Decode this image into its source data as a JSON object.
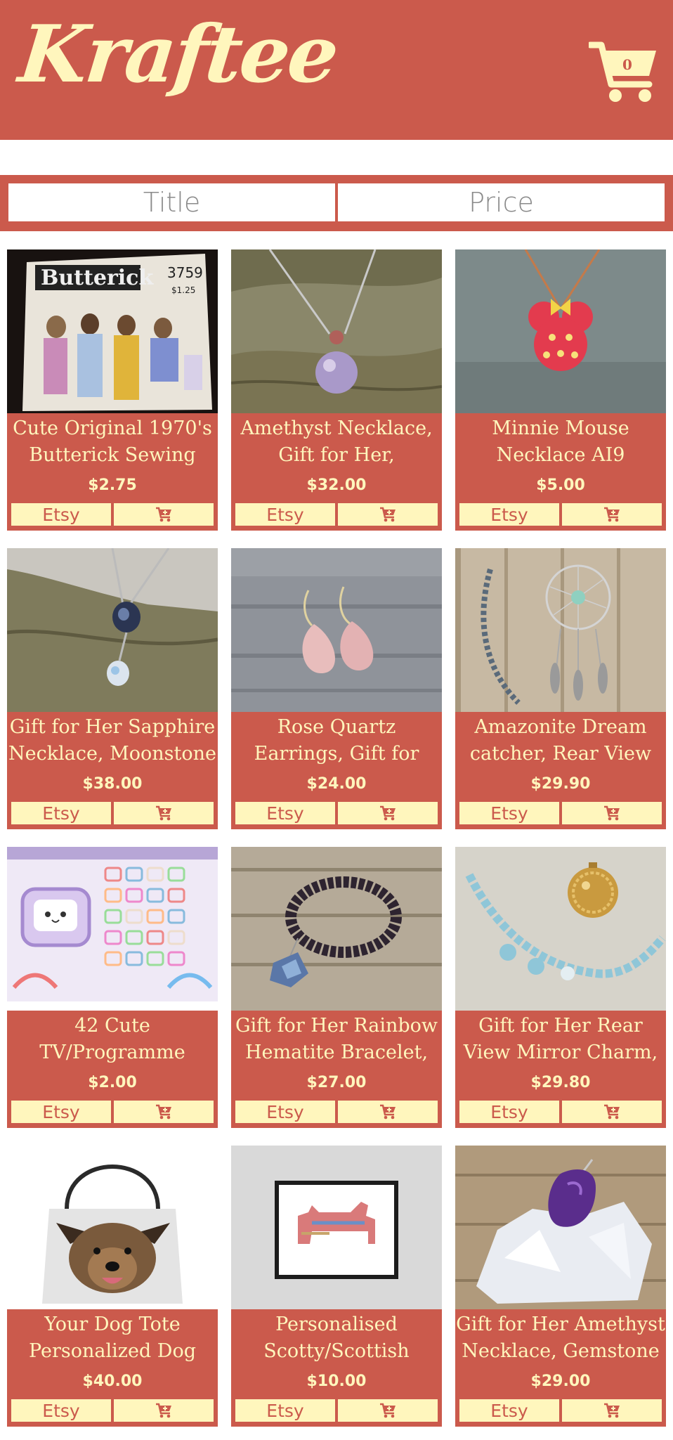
{
  "brand": {
    "name": "Kraftee"
  },
  "cart": {
    "count": "0",
    "icon": "shopping-cart-icon"
  },
  "sort": {
    "title_label": "Title",
    "price_label": "Price"
  },
  "colors": {
    "primary": "#cb5a4c",
    "cream": "#fff6bd"
  },
  "products": [
    {
      "title": "Cute Original 1970's Butterick Sewing",
      "price": "$2.75",
      "shop_label": "Etsy",
      "image": "sewing-pattern"
    },
    {
      "title": "Amethyst Necklace, Gift for Her,",
      "price": "$32.00",
      "shop_label": "Etsy",
      "image": "amethyst-necklace"
    },
    {
      "title": "Minnie Mouse Necklace AI9",
      "price": "$5.00",
      "shop_label": "Etsy",
      "image": "minnie-necklace"
    },
    {
      "title": "Gift for Her Sapphire Necklace, Moonstone",
      "price": "$38.00",
      "shop_label": "Etsy",
      "image": "sapphire-necklace"
    },
    {
      "title": "Rose Quartz Earrings, Gift for Her, Crystal",
      "price": "$24.00",
      "shop_label": "Etsy",
      "image": "rose-quartz-earrings"
    },
    {
      "title": "Amazonite Dream catcher, Rear View",
      "price": "$29.90",
      "shop_label": "Etsy",
      "image": "dream-catcher"
    },
    {
      "title": "42 Cute TV/Programme",
      "price": "$2.00",
      "shop_label": "Etsy",
      "image": "tv-stickers"
    },
    {
      "title": "Gift for Her Rainbow Hematite Bracelet,",
      "price": "$27.00",
      "shop_label": "Etsy",
      "image": "hematite-bracelet"
    },
    {
      "title": "Gift for Her Rear View Mirror Charm,",
      "price": "$29.80",
      "shop_label": "Etsy",
      "image": "mirror-charm"
    },
    {
      "title": "Your Dog Tote Personalized Dog",
      "price": "$40.00",
      "shop_label": "Etsy",
      "image": "dog-tote"
    },
    {
      "title": "Personalised Scotty/Scottish",
      "price": "$10.00",
      "shop_label": "Etsy",
      "image": "scotty-print"
    },
    {
      "title": "Gift for Her Amethyst Necklace, Gemstone",
      "price": "$29.00",
      "shop_label": "Etsy",
      "image": "amethyst-gemstone"
    }
  ]
}
